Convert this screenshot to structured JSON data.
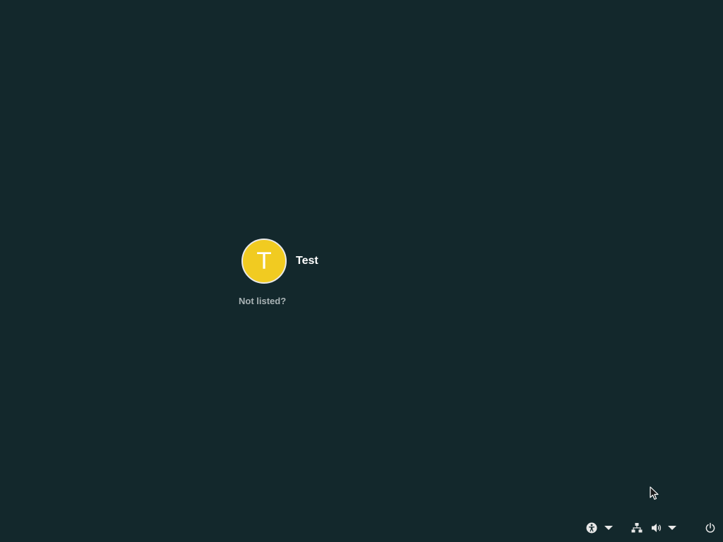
{
  "user": {
    "initial": "T",
    "name": "Test"
  },
  "login": {
    "not_listed_label": "Not listed?"
  },
  "tray": {
    "accessibility_icon": "accessibility-icon",
    "network_icon": "network-wired-icon",
    "volume_icon": "volume-icon",
    "power_icon": "power-icon"
  },
  "colors": {
    "background": "#13282c",
    "avatar": "#f1cb21",
    "text": "#ffffff",
    "muted_text": "#a9b3b5"
  }
}
